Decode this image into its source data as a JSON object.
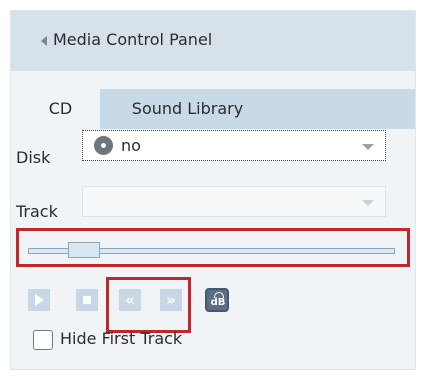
{
  "header": {
    "title": "Media Control Panel",
    "collapse_icon": "triangle-left-icon"
  },
  "tabs": [
    {
      "label": "CD",
      "active": true
    },
    {
      "label": "Sound Library",
      "active": false
    }
  ],
  "form": {
    "disk": {
      "label": "Disk",
      "value": "no",
      "icon": "disc-icon"
    },
    "track": {
      "label": "Track",
      "value": "",
      "enabled": false
    }
  },
  "seek": {
    "position_fraction": 0.12
  },
  "controls": {
    "play_icon": "play-icon",
    "stop_icon": "stop-icon",
    "rewind_glyph": "«",
    "forward_glyph": "»",
    "volume_text": "dB"
  },
  "options": {
    "hide_first_track_label": "Hide First Track",
    "hide_first_track_checked": false
  },
  "colors": {
    "header_bg": "#d7e1ea",
    "tab_bar_bg": "#c8d9e7",
    "highlight_red": "#c0262c",
    "control_bg": "#c7d7e5"
  }
}
